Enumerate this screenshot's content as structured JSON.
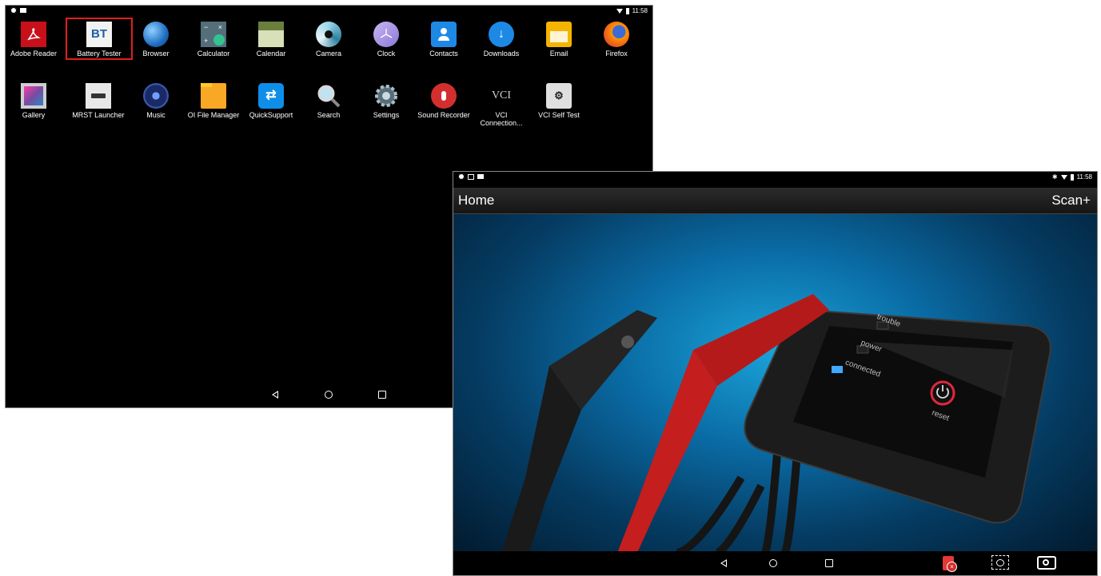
{
  "screen1": {
    "status_time": "11:58",
    "apps_row1": [
      {
        "label": "Adobe Reader",
        "icon": "adobe-reader-icon"
      },
      {
        "label": "Battery Tester",
        "icon": "bt-icon",
        "icon_text": "BT",
        "highlighted": true
      },
      {
        "label": "Browser",
        "icon": "globe-icon"
      },
      {
        "label": "Calculator",
        "icon": "calculator-icon"
      },
      {
        "label": "Calendar",
        "icon": "calendar-icon"
      },
      {
        "label": "Camera",
        "icon": "camera-icon"
      },
      {
        "label": "Clock",
        "icon": "clock-icon"
      },
      {
        "label": "Contacts",
        "icon": "contacts-icon"
      },
      {
        "label": "Downloads",
        "icon": "download-icon"
      },
      {
        "label": "Email",
        "icon": "email-icon"
      },
      {
        "label": "Firefox",
        "icon": "firefox-icon"
      }
    ],
    "apps_row2": [
      {
        "label": "Gallery",
        "icon": "gallery-icon"
      },
      {
        "label": "MRST Launcher",
        "icon": "mrst-icon"
      },
      {
        "label": "Music",
        "icon": "music-icon"
      },
      {
        "label": "OI File Manager",
        "icon": "folder-icon"
      },
      {
        "label": "QuickSupport",
        "icon": "quicksupport-icon"
      },
      {
        "label": "Search",
        "icon": "search-icon"
      },
      {
        "label": "Settings",
        "icon": "settings-icon"
      },
      {
        "label": "Sound Recorder",
        "icon": "microphone-icon"
      },
      {
        "label": "VCI Connection...",
        "icon": "vci-icon",
        "icon_text": "VCI"
      },
      {
        "label": "VCI Self Test",
        "icon": "vci-self-test-icon"
      }
    ]
  },
  "screen2": {
    "status_time": "11:58",
    "title": "Home",
    "scan_label": "Scan+",
    "device_labels": {
      "trouble": "trouble",
      "power": "power",
      "connected": "connected",
      "reset": "reset"
    }
  },
  "colors": {
    "highlight": "#e01e1e",
    "hero_blue": "#0a6aa3"
  }
}
